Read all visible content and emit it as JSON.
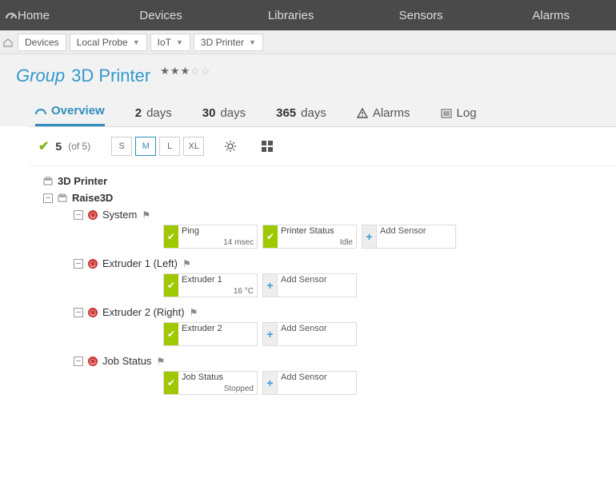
{
  "topnav": [
    "Home",
    "Devices",
    "Libraries",
    "Sensors",
    "Alarms"
  ],
  "breadcrumb": {
    "items": [
      "Devices",
      "Local Probe",
      "IoT",
      "3D Printer"
    ]
  },
  "title": {
    "prefix": "Group",
    "name": "3D Printer",
    "stars_on": 3,
    "stars_off": 2
  },
  "tabs": {
    "overview": "Overview",
    "days2_num": "2",
    "days2_lbl": "days",
    "days30_num": "30",
    "days30_lbl": "days",
    "days365_num": "365",
    "days365_lbl": "days",
    "alarms": "Alarms",
    "log": "Log"
  },
  "toolbar": {
    "count": "5",
    "of": "(of 5)",
    "sizes": [
      "S",
      "M",
      "L",
      "XL"
    ]
  },
  "tree": {
    "root": "3D Printer",
    "device": "Raise3D",
    "groups": {
      "system": {
        "label": "System",
        "sensors": [
          {
            "name": "Ping",
            "value": "14 msec"
          },
          {
            "name": "Printer Status",
            "value": "Idle"
          }
        ]
      },
      "ext1": {
        "label": "Extruder 1 (Left)",
        "sensors": [
          {
            "name": "Extruder 1",
            "value": "16 °C"
          }
        ]
      },
      "ext2": {
        "label": "Extruder 2 (Right)",
        "sensors": [
          {
            "name": "Extruder 2",
            "value": ""
          }
        ]
      },
      "job": {
        "label": "Job Status",
        "sensors": [
          {
            "name": "Job Status",
            "value": "Stopped"
          }
        ]
      }
    },
    "add_sensor": "Add Sensor"
  }
}
